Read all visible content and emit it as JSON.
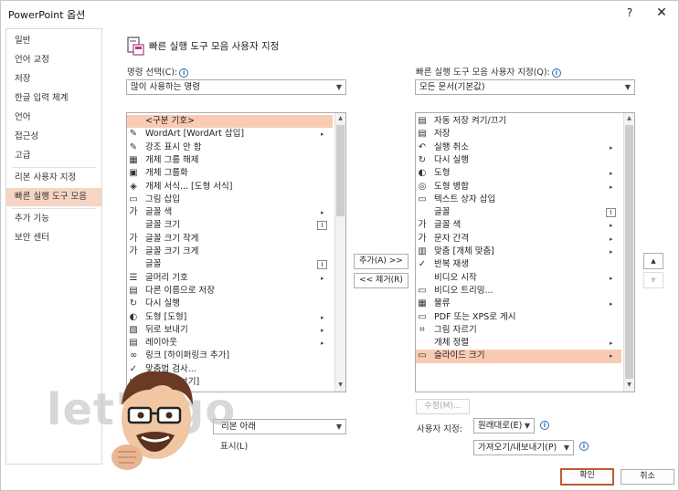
{
  "window": {
    "title": "PowerPoint 옵션",
    "help": "?",
    "close": "✕"
  },
  "sidebar": {
    "items": [
      {
        "label": "일반",
        "active": false
      },
      {
        "label": "언어 교정",
        "active": false
      },
      {
        "label": "저장",
        "active": false
      },
      {
        "label": "한글 입력 체계",
        "active": false
      },
      {
        "label": "언어",
        "active": false
      },
      {
        "label": "접근성",
        "active": false
      },
      {
        "label": "고급",
        "active": false
      },
      {
        "label": "리본 사용자 지정",
        "active": false
      },
      {
        "label": "빠른 실행 도구 모음",
        "active": true
      },
      {
        "label": "추가 기능",
        "active": false
      },
      {
        "label": "보안 센터",
        "active": false
      }
    ]
  },
  "header": {
    "title": "빠른 실행 도구 모음 사용자 지정"
  },
  "left": {
    "choose_label": "명령 선택(C):",
    "choose_value": "많이 사용하는 명령",
    "items": [
      {
        "icon": "",
        "label": "<구분 기호>",
        "selected": true,
        "sub": ""
      },
      {
        "icon": "✎",
        "label": "WordArt [WordArt 삽입]",
        "selected": false,
        "sub": "▸"
      },
      {
        "icon": "✎",
        "label": "강조 표시 안 함",
        "selected": false,
        "sub": ""
      },
      {
        "icon": "▦",
        "label": "개체 그룹 해제",
        "selected": false,
        "sub": ""
      },
      {
        "icon": "▣",
        "label": "개체 그룹화",
        "selected": false,
        "sub": ""
      },
      {
        "icon": "◈",
        "label": "개체 서식... [도형 서식]",
        "selected": false,
        "sub": ""
      },
      {
        "icon": "▭",
        "label": "그림 삽입",
        "selected": false,
        "sub": ""
      },
      {
        "icon": "가",
        "label": "글꼴 색",
        "selected": false,
        "sub": "▸"
      },
      {
        "icon": "",
        "label": "글꼴 크기",
        "selected": false,
        "sub": "I"
      },
      {
        "icon": "가",
        "label": "글꼴 크기 작게",
        "selected": false,
        "sub": ""
      },
      {
        "icon": "가",
        "label": "글꼴 크기 크게",
        "selected": false,
        "sub": ""
      },
      {
        "icon": "",
        "label": "글꼴",
        "selected": false,
        "sub": "I"
      },
      {
        "icon": "☰",
        "label": "글머리 기호",
        "selected": false,
        "sub": "▸"
      },
      {
        "icon": "▤",
        "label": "다른 이름으로 저장",
        "selected": false,
        "sub": ""
      },
      {
        "icon": "↻",
        "label": "다시 실행",
        "selected": false,
        "sub": ""
      },
      {
        "icon": "◐",
        "label": "도형 [도형]",
        "selected": false,
        "sub": "▸"
      },
      {
        "icon": "▧",
        "label": "뒤로 보내기",
        "selected": false,
        "sub": "▸"
      },
      {
        "icon": "▤",
        "label": "레이아웃",
        "selected": false,
        "sub": "▸"
      },
      {
        "icon": "∞",
        "label": "링크 [하이퍼링크 추가]",
        "selected": false,
        "sub": ""
      },
      {
        "icon": "✓",
        "label": "맞춤법 검사...",
        "selected": false,
        "sub": ""
      },
      {
        "icon": "▷",
        "label": "처음부터 보기]",
        "selected": false,
        "sub": ""
      }
    ]
  },
  "right": {
    "custom_label": "빠른 실행 도구 모음 사용자 지정(Q):",
    "custom_value": "모든 문서(기본값)",
    "items": [
      {
        "icon": "▤",
        "label": "자동 저장 켜기/끄기",
        "selected": false,
        "sub": ""
      },
      {
        "icon": "▤",
        "label": "저장",
        "selected": false,
        "sub": ""
      },
      {
        "icon": "↶",
        "label": "실행 취소",
        "selected": false,
        "sub": "▸"
      },
      {
        "icon": "↻",
        "label": "다시 실행",
        "selected": false,
        "sub": ""
      },
      {
        "icon": "◐",
        "label": "도형",
        "selected": false,
        "sub": "▸"
      },
      {
        "icon": "◎",
        "label": "도형 병합",
        "selected": false,
        "sub": "▸"
      },
      {
        "icon": "▭",
        "label": "텍스트 상자 삽입",
        "selected": false,
        "sub": ""
      },
      {
        "icon": "",
        "label": "글꼴",
        "selected": false,
        "sub": "I"
      },
      {
        "icon": "가",
        "label": "글꼴 색",
        "selected": false,
        "sub": "▸"
      },
      {
        "icon": "가",
        "label": "문자 간격",
        "selected": false,
        "sub": "▸"
      },
      {
        "icon": "▥",
        "label": "맞춤 [개체 맞춤]",
        "selected": false,
        "sub": "▸"
      },
      {
        "icon": "✓",
        "label": "반복 재생",
        "selected": false,
        "sub": ""
      },
      {
        "icon": "",
        "label": "비디오 시작",
        "selected": false,
        "sub": "▸"
      },
      {
        "icon": "▭",
        "label": "비디오 트리밍...",
        "selected": false,
        "sub": ""
      },
      {
        "icon": "▦",
        "label": "물류",
        "selected": false,
        "sub": "▸"
      },
      {
        "icon": "▭",
        "label": "PDF 또는 XPS로 게시",
        "selected": false,
        "sub": ""
      },
      {
        "icon": "⌗",
        "label": "그림 자르기",
        "selected": false,
        "sub": ""
      },
      {
        "icon": "",
        "label": "개체 정렬",
        "selected": false,
        "sub": "▸"
      },
      {
        "icon": "▭",
        "label": "슬라이드 크기",
        "selected": true,
        "sub": "▸"
      }
    ],
    "modify_label": "수정(M)...",
    "customize_label": "사용자 지정:",
    "reset_value": "원래대로(E)",
    "import_export_value": "가져오기/내보내기(P)"
  },
  "middle": {
    "add_label": "추가(A) >>",
    "remove_label": "<< 제거(R)"
  },
  "move": {
    "up": "▲",
    "down": "▼"
  },
  "bottom_left": {
    "checkbox_label": "표시(L)",
    "combo_value": "리본 아래"
  },
  "footer": {
    "ok_label": "확인",
    "cancel_label": "취소"
  },
  "watermark": {
    "text": "let's go"
  },
  "colors": {
    "accent": "#c05a2e",
    "selected_row": "#f9cbb3",
    "sidebar_active": "#f6d5c3"
  }
}
